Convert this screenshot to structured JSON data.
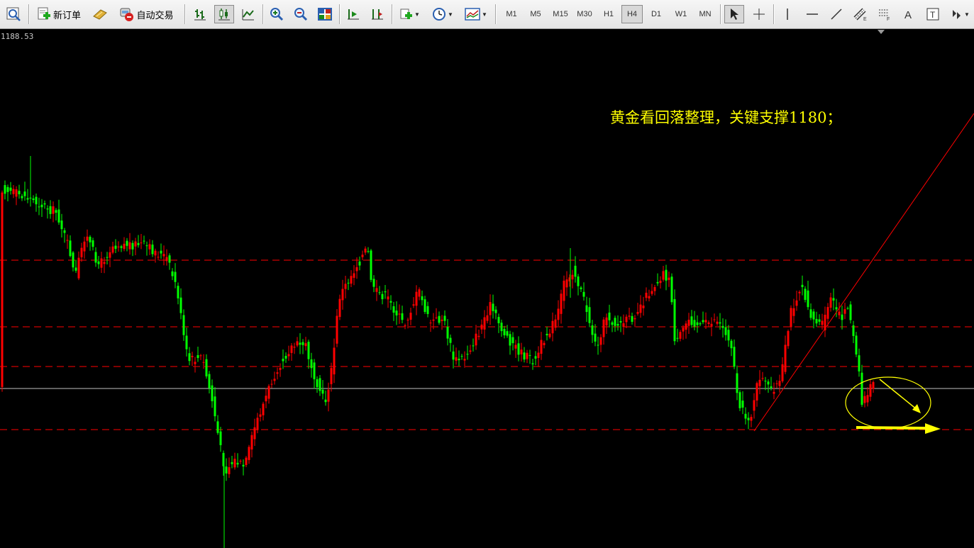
{
  "toolbar": {
    "new_order_label": "新订单",
    "auto_trade_label": "自动交易",
    "timeframes": [
      "M1",
      "M5",
      "M15",
      "M30",
      "H1",
      "H4",
      "D1",
      "W1",
      "MN"
    ],
    "active_timeframe": "H4"
  },
  "chart": {
    "price_label": "1188.53",
    "annotation": "黄金看回落整理，关键支撑1180；",
    "colors": {
      "background": "#000000",
      "bull": "#ff0000",
      "bear": "#00ff00",
      "level_line": "#ff0000",
      "current_line": "#c0c0c0",
      "annotation": "#ffff00"
    }
  }
}
